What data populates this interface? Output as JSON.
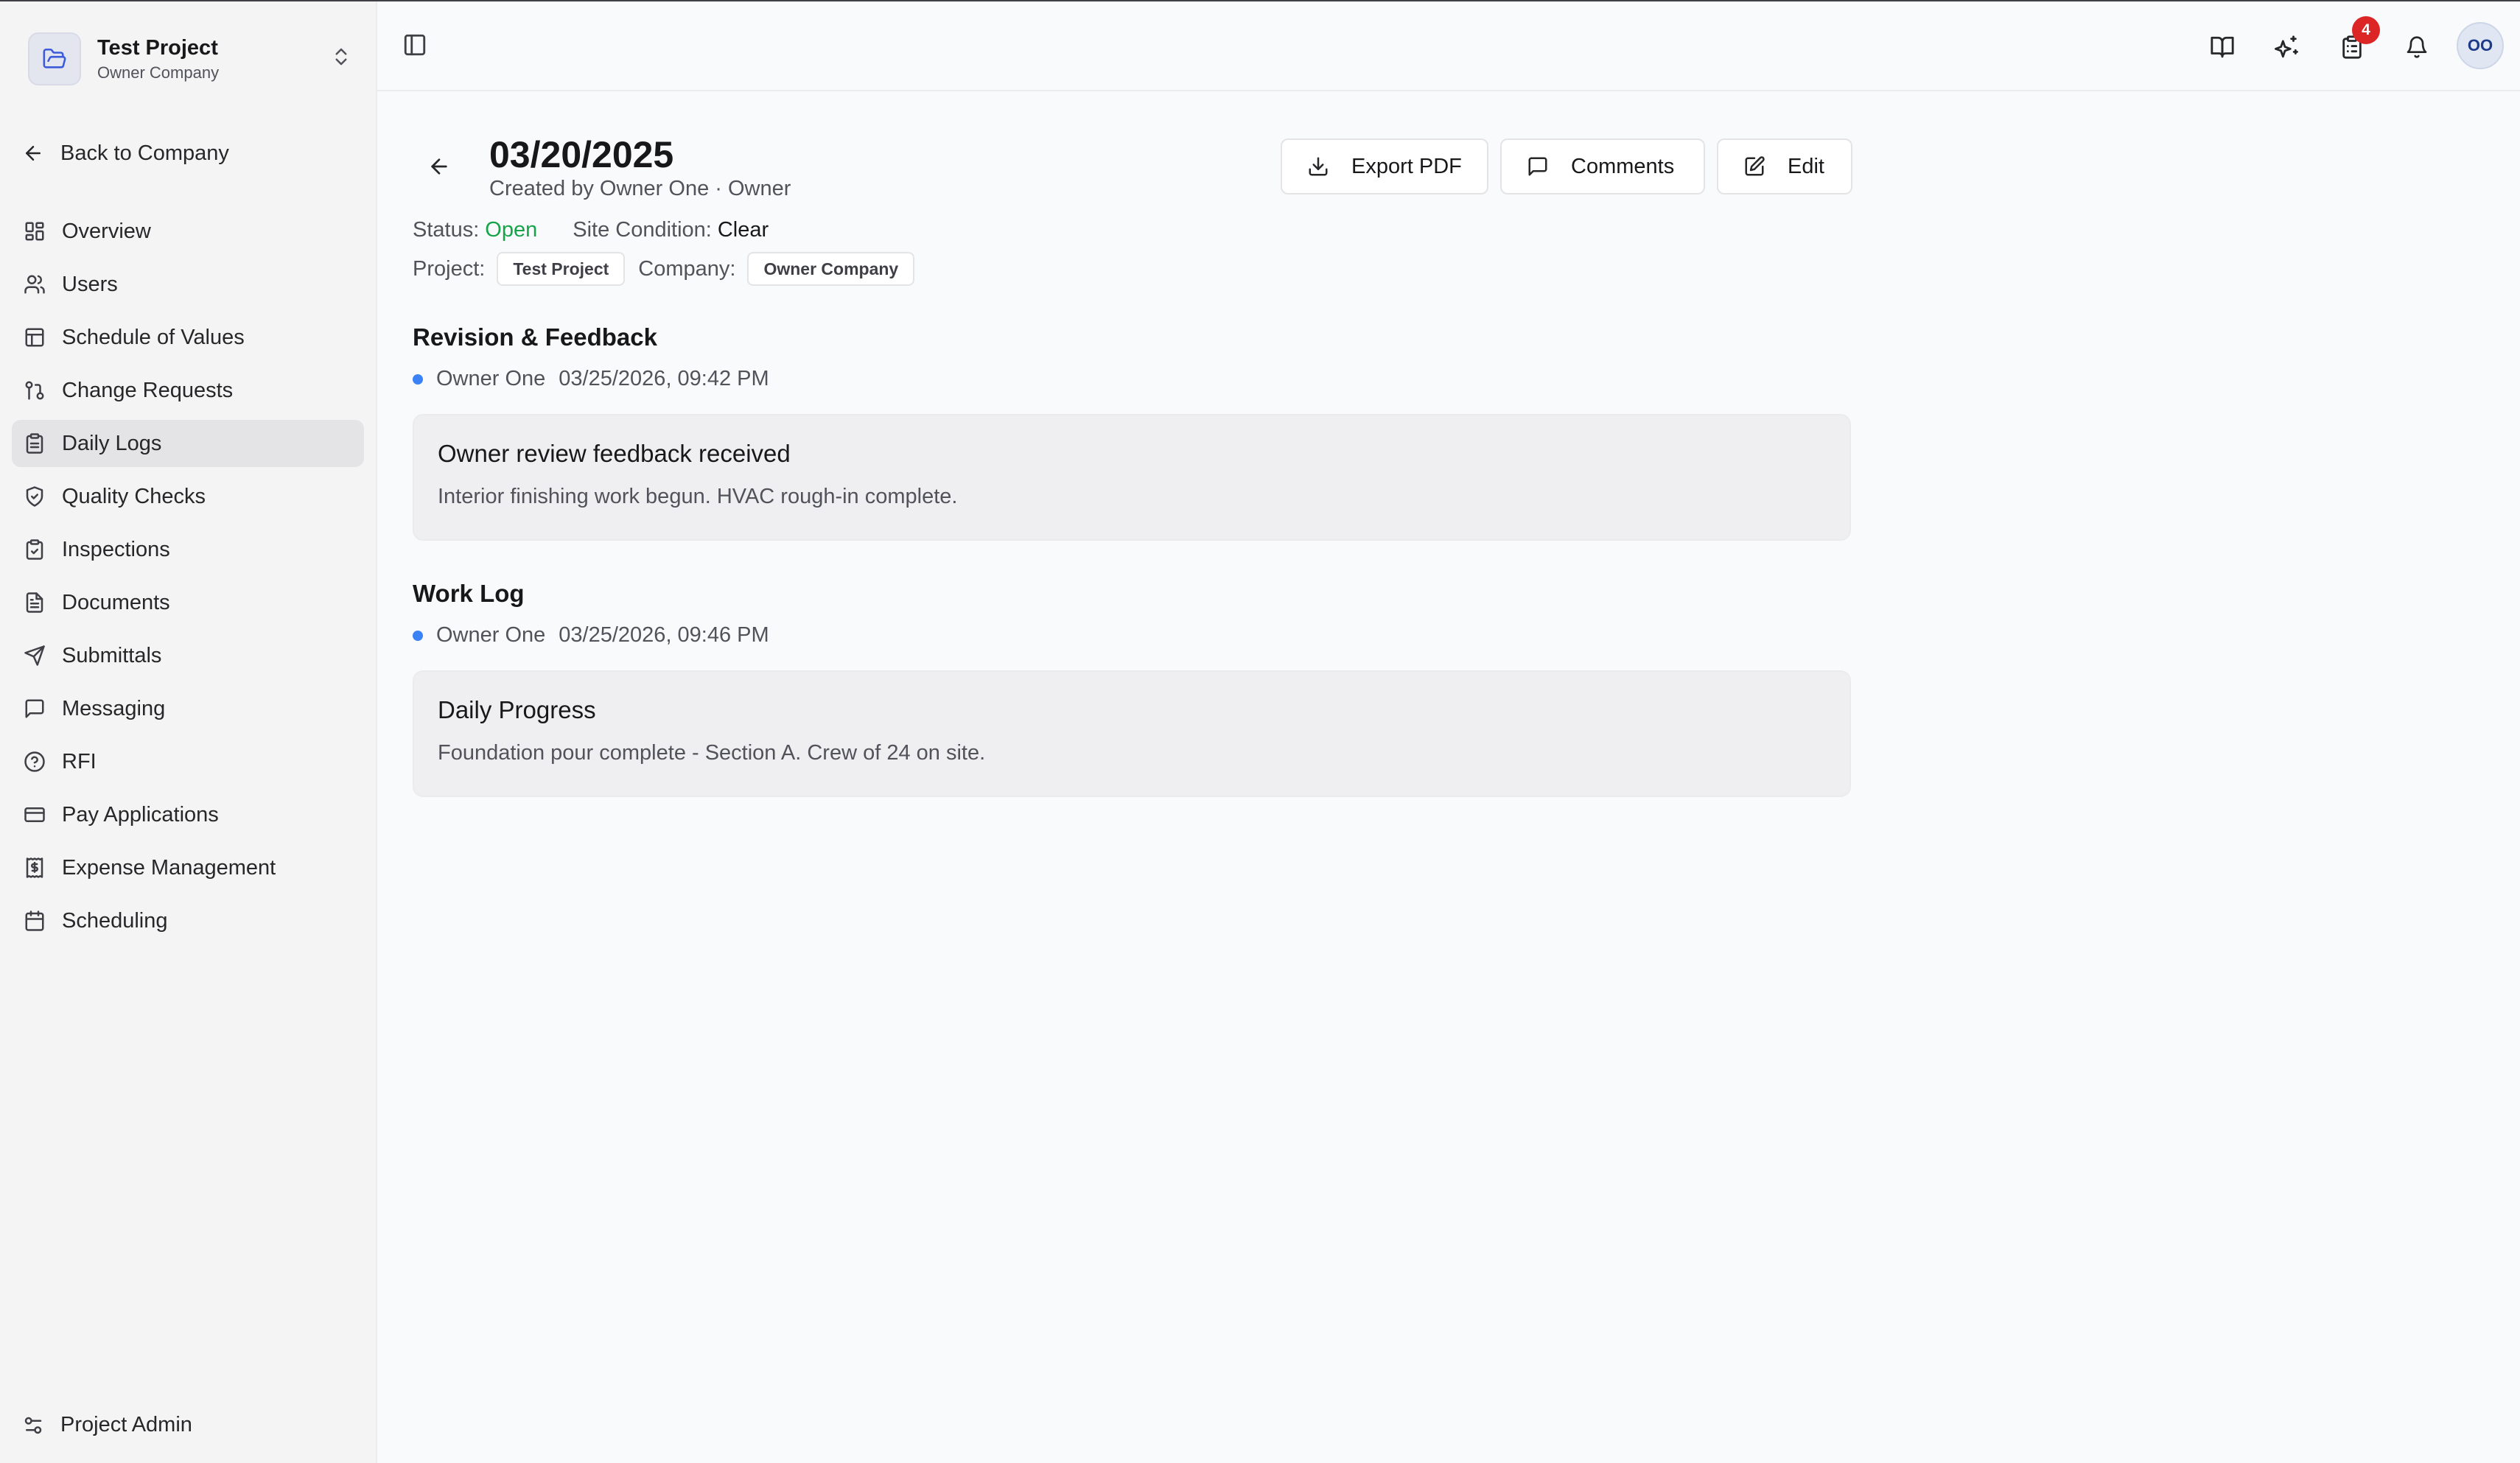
{
  "project": {
    "name": "Test Project",
    "company": "Owner Company"
  },
  "sidebar": {
    "back_label": "Back to Company",
    "items": [
      {
        "label": "Overview",
        "icon": "grid-icon"
      },
      {
        "label": "Users",
        "icon": "users-icon"
      },
      {
        "label": "Schedule of Values",
        "icon": "table-icon"
      },
      {
        "label": "Change Requests",
        "icon": "git-pull-request-icon"
      },
      {
        "label": "Daily Logs",
        "icon": "clipboard-icon",
        "active": true
      },
      {
        "label": "Quality Checks",
        "icon": "shield-check-icon"
      },
      {
        "label": "Inspections",
        "icon": "clipboard-check-icon"
      },
      {
        "label": "Documents",
        "icon": "file-text-icon"
      },
      {
        "label": "Submittals",
        "icon": "send-icon"
      },
      {
        "label": "Messaging",
        "icon": "message-square-icon"
      },
      {
        "label": "RFI",
        "icon": "help-circle-icon"
      },
      {
        "label": "Pay Applications",
        "icon": "credit-card-icon"
      },
      {
        "label": "Expense Management",
        "icon": "receipt-icon"
      },
      {
        "label": "Scheduling",
        "icon": "calendar-icon"
      }
    ],
    "admin_label": "Project Admin"
  },
  "topbar": {
    "notification_count": "4",
    "avatar_initials": "OO",
    "icons": [
      "book-open-icon",
      "sparkles-icon",
      "clipboard-list-icon",
      "bell-icon"
    ]
  },
  "log": {
    "title": "03/20/2025",
    "created_by": "Created by Owner One · Owner",
    "status_label": "Status:",
    "status_value": "Open",
    "site_condition_label": "Site Condition:",
    "site_condition_value": "Clear",
    "project_label": "Project:",
    "project_value": "Test Project",
    "company_label": "Company:",
    "company_value": "Owner Company",
    "status_color": "#16a34a"
  },
  "actions": {
    "export_label": "Export PDF",
    "comments_label": "Comments",
    "edit_label": "Edit"
  },
  "sections": [
    {
      "title": "Revision & Feedback",
      "author": "Owner One",
      "timestamp": "03/25/2026, 09:42 PM",
      "card_title": "Owner review feedback received",
      "card_body": "Interior finishing work begun. HVAC rough-in complete."
    },
    {
      "title": "Work Log",
      "author": "Owner One",
      "timestamp": "03/25/2026, 09:46 PM",
      "card_title": "Daily Progress",
      "card_body": "Foundation pour complete - Section A. Crew of 24 on site."
    }
  ]
}
